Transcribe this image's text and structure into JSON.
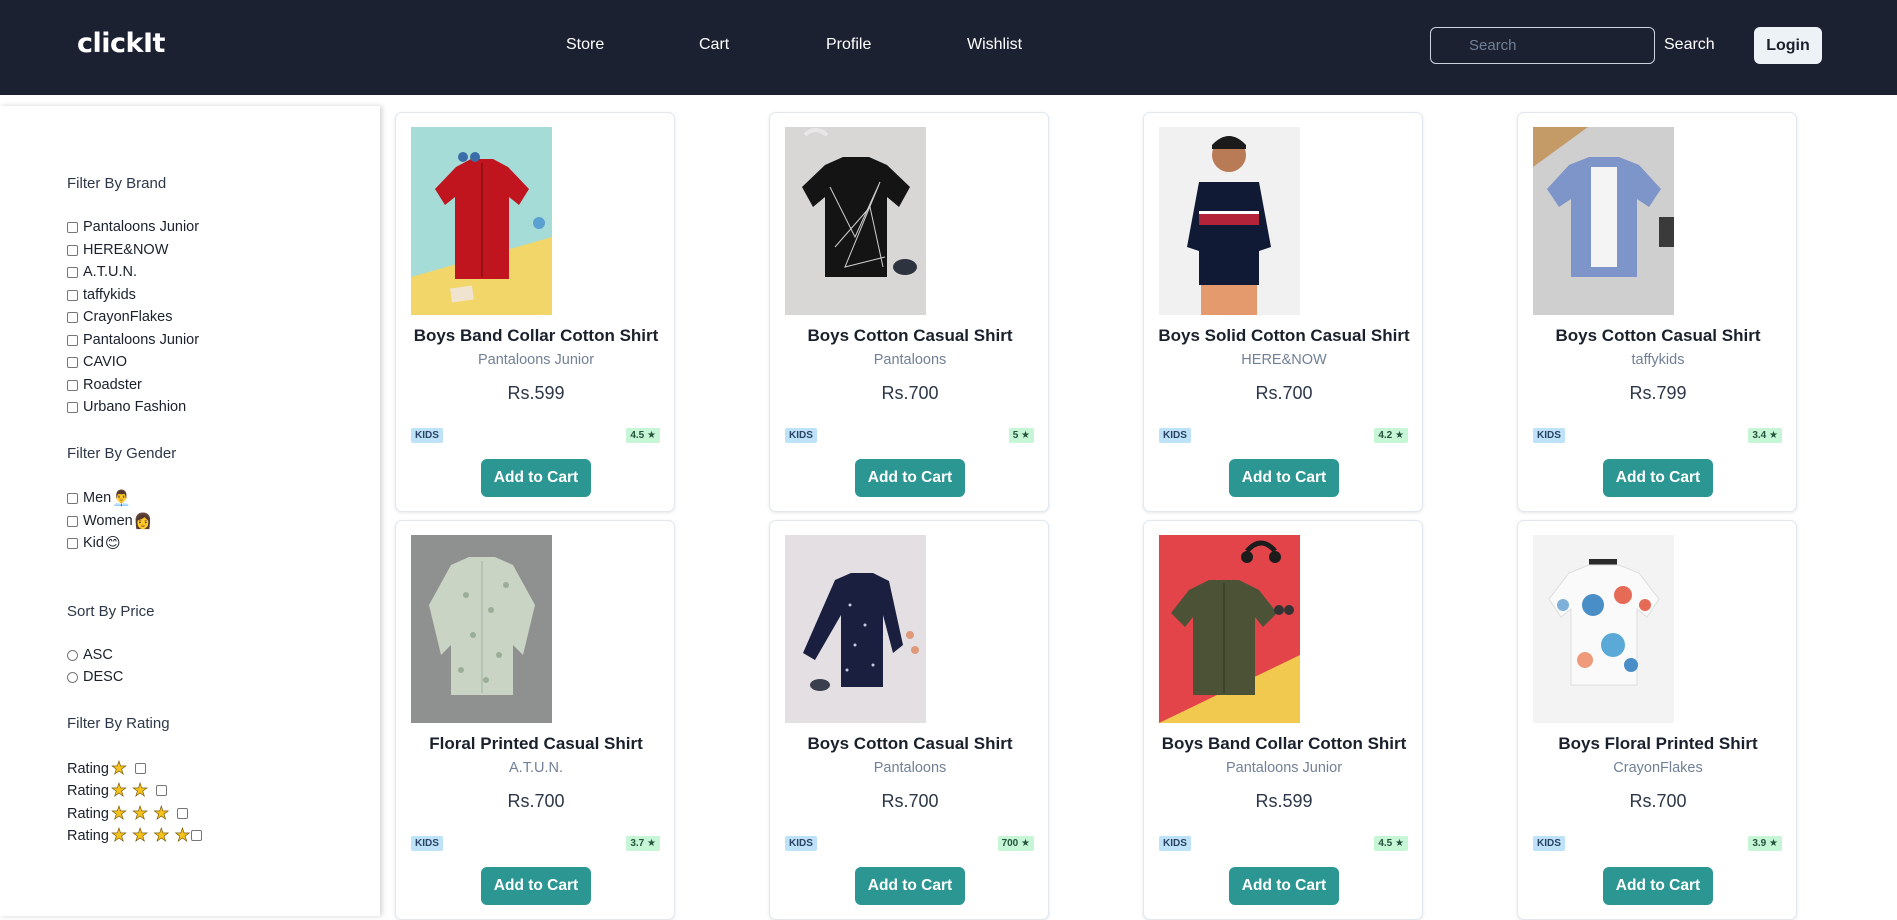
{
  "header": {
    "brand": "clickIt",
    "nav": [
      "Store",
      "Cart",
      "Profile",
      "Wishlist"
    ],
    "search_placeholder": "Search",
    "search_label": "Search",
    "login_label": "Login"
  },
  "colors": {
    "navbar_bg": "#1b2130",
    "accent_button": "#2c9792",
    "category_badge": "#bee3f8",
    "rating_badge": "#c6f6d5"
  },
  "sidebar": {
    "brand_title": "Filter By Brand",
    "brands": [
      "Pantaloons Junior",
      "HERE&NOW",
      "A.T.U.N.",
      "taffykids",
      "CrayonFlakes",
      "Pantaloons Junior",
      "CAVIO",
      "Roadster",
      "Urbano Fashion"
    ],
    "gender_title": "Filter By Gender",
    "genders": [
      {
        "label": "Men",
        "emoji": "👨‍💼"
      },
      {
        "label": "Women",
        "emoji": "👩"
      },
      {
        "label": "Kid",
        "emoji": "😊"
      }
    ],
    "sort_title": "Sort By Price",
    "sort_options": [
      "ASC",
      "DESC"
    ],
    "rating_title": "Filter By Rating",
    "rating_label": "Rating",
    "rating_levels": [
      1,
      2,
      3,
      4
    ]
  },
  "products": [
    {
      "title": "Boys Band Collar Cotton Shirt",
      "brand": "Pantaloons Junior",
      "price": "Rs.599",
      "category": "KIDS",
      "rating": "4.5 ★",
      "image": "red-shirt-yellow-bg",
      "button": "Add to Cart"
    },
    {
      "title": "Boys Cotton Casual Shirt",
      "brand": "Pantaloons",
      "price": "Rs.700",
      "category": "KIDS",
      "rating": "5 ★",
      "image": "black-geometric-shirt",
      "button": "Add to Cart"
    },
    {
      "title": "Boys Solid Cotton Casual Shirt",
      "brand": "HERE&NOW",
      "price": "Rs.700",
      "category": "KIDS",
      "rating": "4.2 ★",
      "image": "boy-navy-red-stripe-shirt",
      "button": "Add to Cart"
    },
    {
      "title": "Boys Cotton Casual Shirt",
      "brand": "taffykids",
      "price": "Rs.799",
      "category": "KIDS",
      "rating": "3.4 ★",
      "image": "blue-denim-shirt",
      "button": "Add to Cart"
    },
    {
      "title": "Floral Printed Casual Shirt",
      "brand": "A.T.U.N.",
      "price": "Rs.700",
      "category": "KIDS",
      "rating": "3.7 ★",
      "image": "sage-floral-shirt",
      "button": "Add to Cart"
    },
    {
      "title": "Boys Cotton Casual Shirt",
      "brand": "Pantaloons",
      "price": "Rs.700",
      "category": "KIDS",
      "rating": "700 ★",
      "image": "navy-dotted-shirt",
      "button": "Add to Cart"
    },
    {
      "title": "Boys Band Collar Cotton Shirt",
      "brand": "Pantaloons Junior",
      "price": "Rs.599",
      "category": "KIDS",
      "rating": "4.5 ★",
      "image": "olive-shirt-red-yellow-bg",
      "button": "Add to Cart"
    },
    {
      "title": "Boys Floral Printed Shirt",
      "brand": "CrayonFlakes",
      "price": "Rs.700",
      "category": "KIDS",
      "rating": "3.9 ★",
      "image": "white-blue-floral-shirt",
      "button": "Add to Cart"
    }
  ]
}
